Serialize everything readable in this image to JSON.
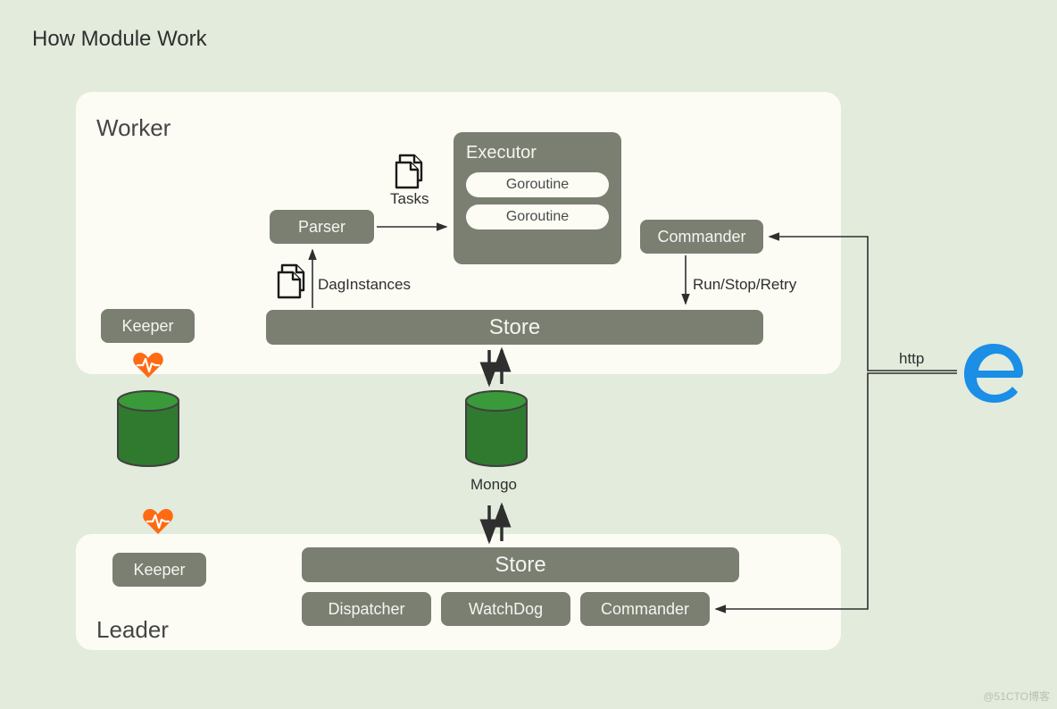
{
  "title": "How Module Work",
  "sections": {
    "worker": "Worker",
    "leader": "Leader"
  },
  "worker": {
    "keeper": "Keeper",
    "parser": "Parser",
    "executor": {
      "label": "Executor",
      "goroutines": [
        "Goroutine",
        "Goroutine"
      ]
    },
    "commander": "Commander",
    "store": "Store"
  },
  "labels": {
    "tasks": "Tasks",
    "dag_instances": "DagInstances",
    "run_stop_retry": "Run/Stop/Retry",
    "mongo": "Mongo",
    "http": "http"
  },
  "leader": {
    "keeper": "Keeper",
    "store": "Store",
    "dispatcher": "Dispatcher",
    "watchdog": "WatchDog",
    "commander": "Commander"
  },
  "watermark": "@51CTO博客",
  "icons": {
    "doc": "documents-icon",
    "heart": "heartbeat-icon",
    "db": "database-icon",
    "edge": "edge-browser-icon"
  },
  "colors": {
    "bg": "#e2ebdc",
    "panel": "#fcfcf5",
    "box": "#7b7f72",
    "db": "#2f7a2f",
    "heart": "#ff6a13",
    "edge": "#1b8ee6"
  }
}
